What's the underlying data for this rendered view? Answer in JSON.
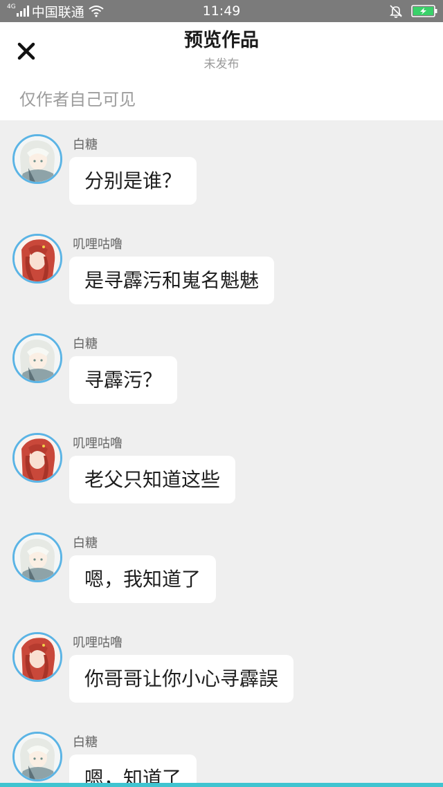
{
  "status_bar": {
    "network_type": "4G",
    "carrier": "中国联通",
    "time": "11:49"
  },
  "header": {
    "title": "预览作品",
    "subtitle": "未发布",
    "visibility_note": "仅作者自己可见"
  },
  "messages": [
    {
      "sender": "白糖",
      "avatar": "white-hair-character-avatar",
      "text": "分别是谁？"
    },
    {
      "sender": "叽哩咕噜",
      "avatar": "red-hair-character-avatar",
      "text": "是寻霹污和嵬名魁魅"
    },
    {
      "sender": "白糖",
      "avatar": "white-hair-character-avatar",
      "text": "寻霹污？"
    },
    {
      "sender": "叽哩咕噜",
      "avatar": "red-hair-character-avatar",
      "text": "老父只知道这些"
    },
    {
      "sender": "白糖",
      "avatar": "white-hair-character-avatar",
      "text": "嗯，我知道了"
    },
    {
      "sender": "叽哩咕噜",
      "avatar": "red-hair-character-avatar",
      "text": "你哥哥让你小心寻霹誤"
    },
    {
      "sender": "白糖",
      "avatar": "white-hair-character-avatar",
      "text": "嗯，知道了"
    }
  ],
  "colors": {
    "status_bar_bg": "#7b7b7b",
    "chat_bg": "#efefef",
    "avatar_ring": "#5bb4e5",
    "bottom_accent": "#40c4d0"
  }
}
